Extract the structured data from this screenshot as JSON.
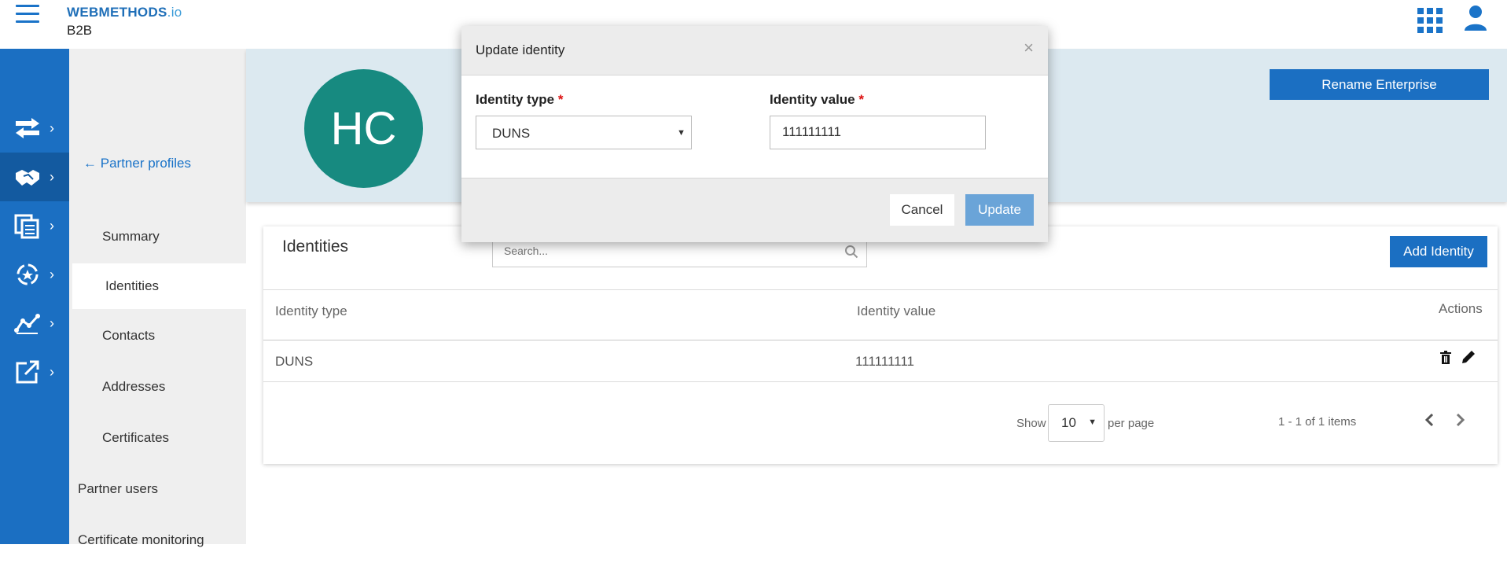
{
  "header": {
    "brand_name": "WEBMETHODS",
    "brand_suffix": ".io",
    "product": "B2B",
    "apps_icon": "apps-grid-icon",
    "user_icon": "user-icon"
  },
  "rail": {
    "items": [
      {
        "icon": "transfer-icon",
        "active": false
      },
      {
        "icon": "handshake-icon",
        "active": true
      },
      {
        "icon": "documents-icon",
        "active": false
      },
      {
        "icon": "process-icon",
        "active": false
      },
      {
        "icon": "analytics-icon",
        "active": false
      },
      {
        "icon": "external-link-icon",
        "active": false
      }
    ],
    "chevron": "›"
  },
  "subnav": {
    "back_label": "Partner profiles",
    "back_arrow": "←",
    "items": [
      {
        "label": "Summary"
      },
      {
        "label": "Identities"
      },
      {
        "label": "Contacts"
      },
      {
        "label": "Addresses"
      },
      {
        "label": "Certificates"
      },
      {
        "label": "Partner users"
      },
      {
        "label": "Certificate monitoring"
      }
    ]
  },
  "banner": {
    "avatar_initials": "HC",
    "rename_label": "Rename Enterprise"
  },
  "panel": {
    "title": "Identities",
    "search_placeholder": "Search...",
    "add_label": "Add Identity",
    "columns": [
      "Identity type",
      "Identity value",
      "Actions"
    ],
    "rows": [
      {
        "type": "DUNS",
        "value": "111111111"
      }
    ],
    "show_label": "Show",
    "per_page_value": "10",
    "per_page_label": "per page",
    "range_text": "1 - 1 of 1 items"
  },
  "dialog": {
    "title": "Update identity",
    "close": "×",
    "type_label": "Identity type",
    "value_label": "Identity value",
    "required_mark": "*",
    "type_value": "DUNS",
    "value_value": "111111111",
    "cancel_label": "Cancel",
    "update_label": "Update"
  },
  "colors": {
    "primary": "#1b6fc2",
    "avatar": "#178a80",
    "banner": "#dce9f0",
    "update_disabled": "#6aa4d8"
  }
}
